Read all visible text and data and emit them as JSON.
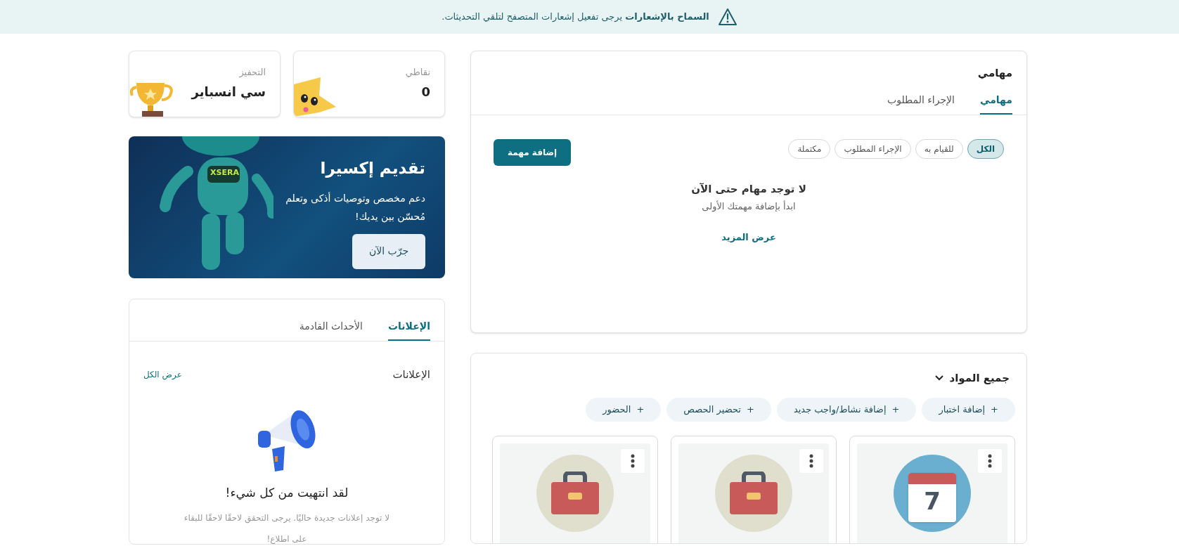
{
  "notice": {
    "title": "السماح بالإشعارات",
    "message": "يرجى تفعيل إشعارات المتصفح لتلقي التحديثات."
  },
  "tasks": {
    "title": "مهامي",
    "tabs": [
      {
        "label": "مهامي",
        "selected": true
      },
      {
        "label": "الإجراء المطلوب",
        "selected": false
      }
    ],
    "filters": [
      {
        "label": "الكل",
        "selected": true
      },
      {
        "label": "للقيام به",
        "selected": false
      },
      {
        "label": "الإجراء المطلوب",
        "selected": false
      },
      {
        "label": "مكتملة",
        "selected": false
      }
    ],
    "add_button": "إضافة مهمة",
    "empty_title": "لا توجد مهام حتى الآن",
    "empty_subtitle": "ابدأ بإضافة مهمتك الأولى",
    "more_link": "عرض المزيد"
  },
  "stats": [
    {
      "kind": "points",
      "label": "نقاطي",
      "value": "0"
    },
    {
      "kind": "motivation",
      "label": "التحفيز",
      "value": "سي انسباير"
    }
  ],
  "promo": {
    "title": "تقديم إكسيرا",
    "text": "دعم مخصص وتوصيات أذكى وتعلم مُحسّن بين يديك!",
    "button": "جرّب الآن",
    "robot_label": "XSERA"
  },
  "announcements": {
    "tabs": [
      {
        "label": "الإعلانات",
        "selected": true
      },
      {
        "label": "الأحداث القادمة",
        "selected": false
      }
    ],
    "heading": "الإعلانات",
    "view_all": "عرض الكل",
    "empty_title": "لقد انتهيت من كل شيء!",
    "empty_text": "لا توجد إعلانات جديدة حاليًا. يرجى التحقق لاحقًا لاحقًا للبقاء على اطلاع!"
  },
  "subjects": {
    "title": "جميع المواد",
    "actions": [
      "إضافة اختبار",
      "إضافة نشاط/واجب جديد",
      "تحضير الحصص",
      "الحضور"
    ],
    "action_mark": "+",
    "cards": [
      {
        "kind": "calendar",
        "day": "7"
      },
      {
        "kind": "briefcase"
      },
      {
        "kind": "briefcase"
      }
    ]
  }
}
